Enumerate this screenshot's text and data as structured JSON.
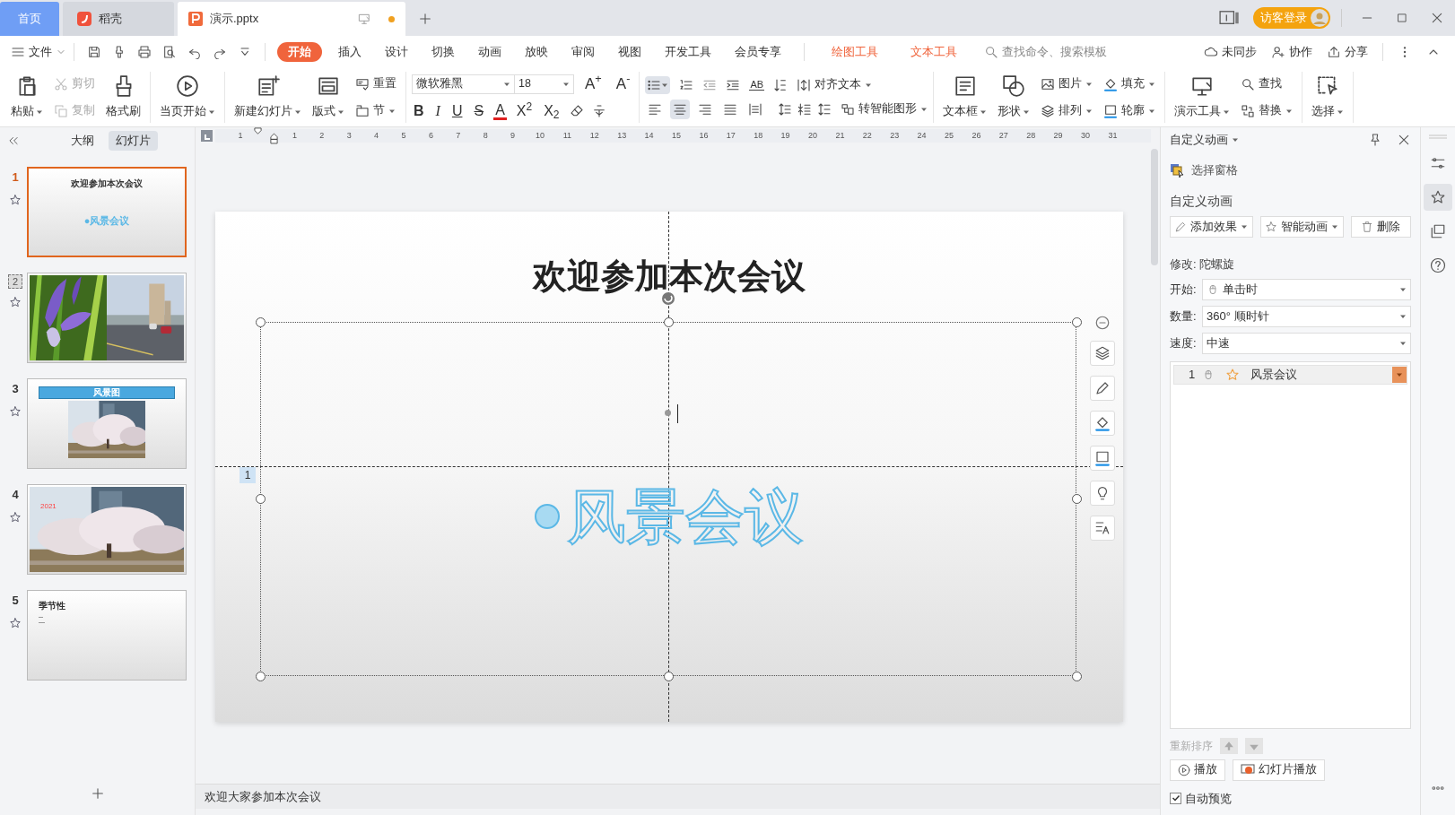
{
  "title_tabs": [
    {
      "label": "首页",
      "kind": "home",
      "selected": false
    },
    {
      "label": "稻壳",
      "kind": "app",
      "selected": false
    },
    {
      "label": "演示.pptx",
      "kind": "doc",
      "selected": true
    }
  ],
  "login_button": "访客登录",
  "menu": {
    "file": "文件",
    "tabs": [
      {
        "label": "开始",
        "selected": true
      },
      {
        "label": "插入",
        "selected": false
      },
      {
        "label": "设计",
        "selected": false
      },
      {
        "label": "切换",
        "selected": false
      },
      {
        "label": "动画",
        "selected": false
      },
      {
        "label": "放映",
        "selected": false
      },
      {
        "label": "审阅",
        "selected": false
      },
      {
        "label": "视图",
        "selected": false
      },
      {
        "label": "开发工具",
        "selected": false
      },
      {
        "label": "会员专享",
        "selected": false
      }
    ],
    "context_tabs": [
      "绘图工具",
      "文本工具"
    ],
    "search_placeholder": "查找命令、搜索模板",
    "actions": [
      "未同步",
      "协作",
      "分享"
    ]
  },
  "ribbon": {
    "clipboard": [
      {
        "kind": "large",
        "label": "粘贴",
        "dropdown": true
      },
      {
        "kind": "stack",
        "items": [
          {
            "label": "剪切",
            "disabled": true
          },
          {
            "label": "复制",
            "disabled": true
          }
        ]
      },
      {
        "kind": "large",
        "label": "格式刷",
        "dropdown": false
      }
    ],
    "show": [
      {
        "kind": "large",
        "label": "当页开始",
        "dropdown": true
      }
    ],
    "slides": [
      {
        "kind": "large",
        "label": "新建幻灯片",
        "dropdown": true
      },
      {
        "kind": "large",
        "label": "版式",
        "dropdown": true
      },
      {
        "kind": "stack",
        "items": [
          {
            "label": "重置",
            "disabled": false
          },
          {
            "label": "节",
            "disabled": false,
            "dropdown": true
          }
        ]
      }
    ],
    "font": {
      "family": "微软雅黑",
      "size": "18",
      "grow": "A$^{+}$",
      "shrink": "A$^{-}$",
      "styles": [
        "B",
        "I",
        "U",
        "S",
        "A",
        "X$^{2}$",
        "X$_{2}$"
      ]
    },
    "paragraph": {
      "bullets_on": true,
      "case_button": "AB",
      "align": [
        {
          "selected": false
        },
        {
          "selected": true
        },
        {
          "selected": false
        },
        {
          "selected": false
        },
        {
          "selected": false
        }
      ],
      "align_text": "对齐文本",
      "smart_art": "转智能图形"
    },
    "drawing": [
      {
        "kind": "large",
        "label": "文本框",
        "dropdown": true
      },
      {
        "kind": "large",
        "label": "形状",
        "dropdown": true
      },
      {
        "kind": "stack",
        "items": [
          {
            "label": "图片",
            "disabled": false,
            "dropdown": true
          },
          {
            "label": "排列",
            "disabled": false,
            "dropdown": true
          }
        ]
      },
      {
        "kind": "stack",
        "items": [
          {
            "label": "填充",
            "disabled": false,
            "dropdown": true
          },
          {
            "label": "轮廓",
            "disabled": false,
            "dropdown": true
          }
        ]
      }
    ],
    "tools": [
      {
        "kind": "large",
        "label": "演示工具",
        "dropdown": true
      },
      {
        "kind": "stack",
        "items": [
          {
            "label": "查找",
            "disabled": false
          },
          {
            "label": "替换",
            "disabled": false,
            "dropdown": true
          }
        ]
      }
    ],
    "select": [
      {
        "kind": "large",
        "label": "选择",
        "dropdown": true
      }
    ]
  },
  "view_tabs": [
    {
      "label": "大纲",
      "selected": false
    },
    {
      "label": "幻灯片",
      "selected": true
    }
  ],
  "slides": [
    {
      "number": "1",
      "selected": true,
      "hidden": false,
      "kind": "title",
      "title": "欢迎参加本次会议",
      "subtitle": "●风景会议"
    },
    {
      "number": "2",
      "selected": false,
      "hidden": true,
      "kind": "photos"
    },
    {
      "number": "3",
      "selected": false,
      "hidden": false,
      "kind": "banner",
      "banner": "风景图"
    },
    {
      "number": "4",
      "selected": false,
      "hidden": false,
      "caption": "2021"
    },
    {
      "number": "5",
      "selected": false,
      "hidden": false,
      "kind": "text",
      "heading": "季节性"
    }
  ],
  "ruler": [
    "1",
    "1",
    "2",
    "3",
    "4",
    "5",
    "6",
    "7",
    "8",
    "9",
    "10",
    "11",
    "12",
    "13",
    "14",
    "15",
    "16",
    "17",
    "18",
    "19",
    "20",
    "21",
    "22",
    "23",
    "24",
    "25",
    "26",
    "27",
    "28",
    "29",
    "30",
    "31"
  ],
  "slide": {
    "title": "欢迎参加本次会议",
    "body": "风景会议",
    "animation_tag": "1"
  },
  "notes": "欢迎大家参加本次会议",
  "panel": {
    "header": "自定义动画",
    "selection_pane": "选择窗格",
    "section": "自定义动画",
    "buttons": [
      "添加效果",
      "智能动画",
      "删除"
    ],
    "modify": "修改: 陀螺旋",
    "fields": [
      {
        "label": "开始:",
        "value": "单击时",
        "kind": "mouse"
      },
      {
        "label": "数量:",
        "value": "360° 顺时针",
        "kind": "plain"
      },
      {
        "label": "速度:",
        "value": "中速",
        "kind": "plain"
      }
    ],
    "effects": [
      {
        "order": "1",
        "name": "风景会议",
        "selected": true
      }
    ],
    "reorder": "重新排序",
    "play_buttons": [
      "播放",
      "幻灯片播放"
    ],
    "auto_preview": {
      "label": "自动预览",
      "checked": true
    }
  },
  "side_strip": [
    {
      "selected": false
    },
    {
      "selected": true
    },
    {
      "selected": false
    },
    {
      "selected": false
    }
  ]
}
